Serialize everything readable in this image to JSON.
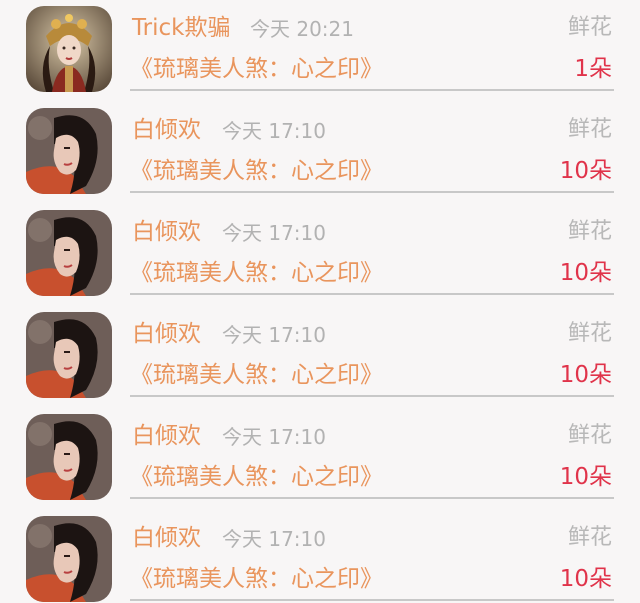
{
  "items": [
    {
      "name": "Trick欺骗",
      "time": "今天 20:21",
      "gift": "鲜花",
      "book": "《琉璃美人煞：心之印》",
      "count": "1朵",
      "avatar_icon": "ornate-woman-avatar-icon"
    },
    {
      "name": "白倾欢",
      "time": "今天 17:10",
      "gift": "鲜花",
      "book": "《琉璃美人煞：心之印》",
      "count": "10朵",
      "avatar_icon": "woman-profile-avatar-icon"
    },
    {
      "name": "白倾欢",
      "time": "今天 17:10",
      "gift": "鲜花",
      "book": "《琉璃美人煞：心之印》",
      "count": "10朵",
      "avatar_icon": "woman-profile-avatar-icon"
    },
    {
      "name": "白倾欢",
      "time": "今天 17:10",
      "gift": "鲜花",
      "book": "《琉璃美人煞：心之印》",
      "count": "10朵",
      "avatar_icon": "woman-profile-avatar-icon"
    },
    {
      "name": "白倾欢",
      "time": "今天 17:10",
      "gift": "鲜花",
      "book": "《琉璃美人煞：心之印》",
      "count": "10朵",
      "avatar_icon": "woman-profile-avatar-icon"
    },
    {
      "name": "白倾欢",
      "time": "今天 17:10",
      "gift": "鲜花",
      "book": "《琉璃美人煞：心之印》",
      "count": "10朵",
      "avatar_icon": "woman-profile-avatar-icon"
    }
  ],
  "colors": {
    "background": "#f8f6f6",
    "name_accent": "#e9955d",
    "count_red": "#e0334a",
    "muted_gray": "#b2b2b2",
    "divider": "#c8c8c8"
  }
}
